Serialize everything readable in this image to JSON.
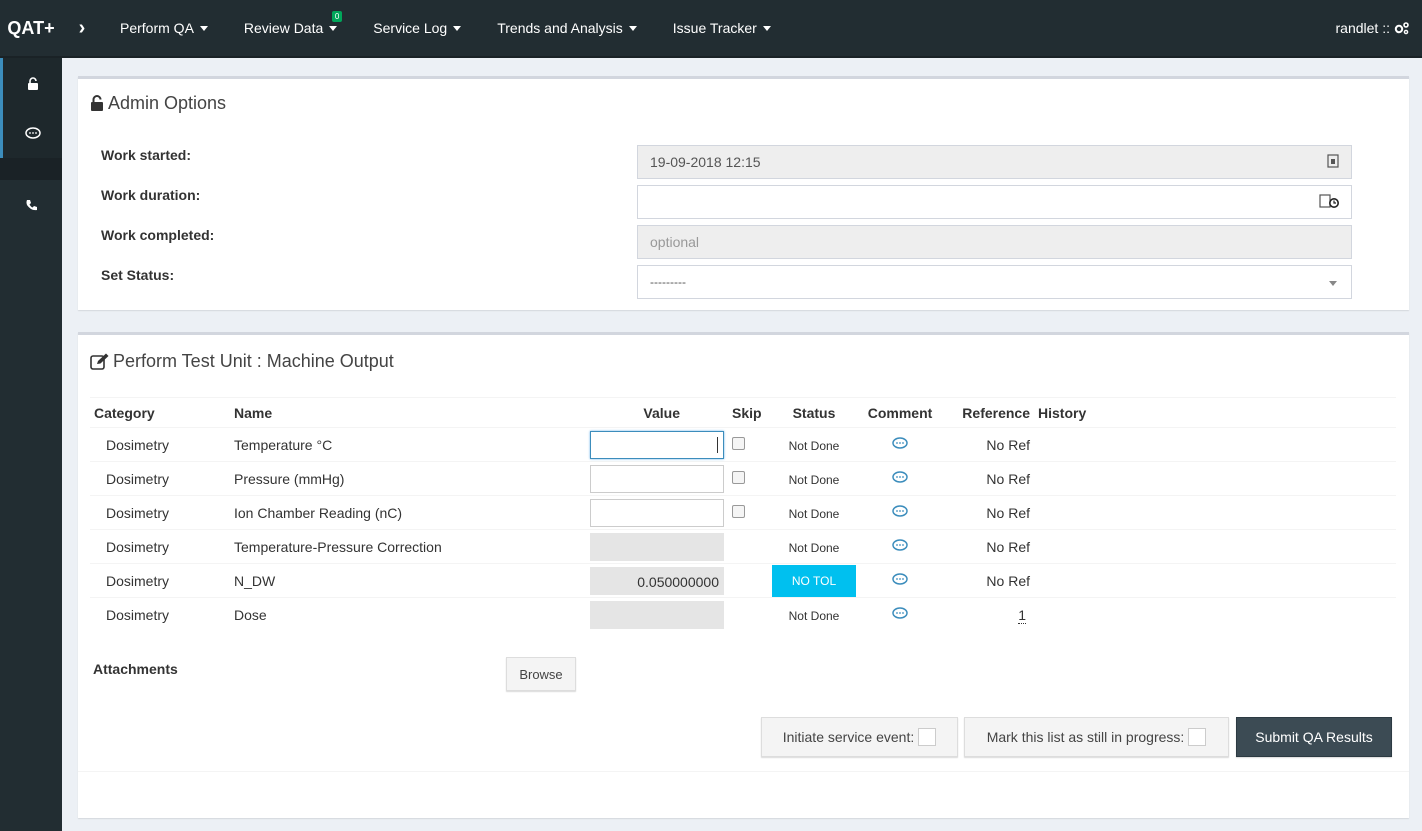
{
  "brand": "QAT+",
  "nav": {
    "items": [
      {
        "label": "Perform QA"
      },
      {
        "label": "Review Data",
        "badge": "0"
      },
      {
        "label": "Service Log"
      },
      {
        "label": "Trends and Analysis"
      },
      {
        "label": "Issue Tracker"
      }
    ],
    "user": "randlet ::"
  },
  "admin": {
    "title": "Admin Options",
    "work_started_label": "Work started:",
    "work_started_value": "19-09-2018 12:15",
    "work_duration_label": "Work duration:",
    "work_duration_value": "",
    "work_completed_label": "Work completed:",
    "work_completed_placeholder": "optional",
    "set_status_label": "Set Status:",
    "set_status_value": "---------"
  },
  "test_unit": {
    "title": "Perform Test Unit : Machine Output",
    "columns": [
      "Category",
      "Name",
      "Value",
      "Skip",
      "Status",
      "Comment",
      "Reference",
      "History"
    ],
    "rows": [
      {
        "category": "Dosimetry",
        "name": "Temperature °C",
        "value": "",
        "status": "Not Done",
        "reference": "No Ref"
      },
      {
        "category": "Dosimetry",
        "name": "Pressure (mmHg)",
        "value": "",
        "status": "Not Done",
        "reference": "No Ref"
      },
      {
        "category": "Dosimetry",
        "name": "Ion Chamber Reading (nC)",
        "value": "",
        "status": "Not Done",
        "reference": "No Ref"
      },
      {
        "category": "Dosimetry",
        "name": "Temperature-Pressure Correction",
        "value": "",
        "status": "Not Done",
        "reference": "No Ref"
      },
      {
        "category": "Dosimetry",
        "name": "N_DW",
        "value": "0.050000000",
        "status": "NO TOL",
        "reference": "No Ref"
      },
      {
        "category": "Dosimetry",
        "name": "Dose",
        "value": "",
        "status": "Not Done",
        "reference": "1"
      }
    ],
    "attachments_label": "Attachments",
    "browse_label": "Browse",
    "initiate_label": "Initiate service event:",
    "in_progress_label": "Mark this list as still in progress:",
    "submit_label": "Submit QA Results"
  },
  "colors": {
    "nav_bg": "#222d32",
    "notol": "#00c0ef",
    "submit_bg": "#3c4b54",
    "comment_icon": "#3c8dbc"
  }
}
